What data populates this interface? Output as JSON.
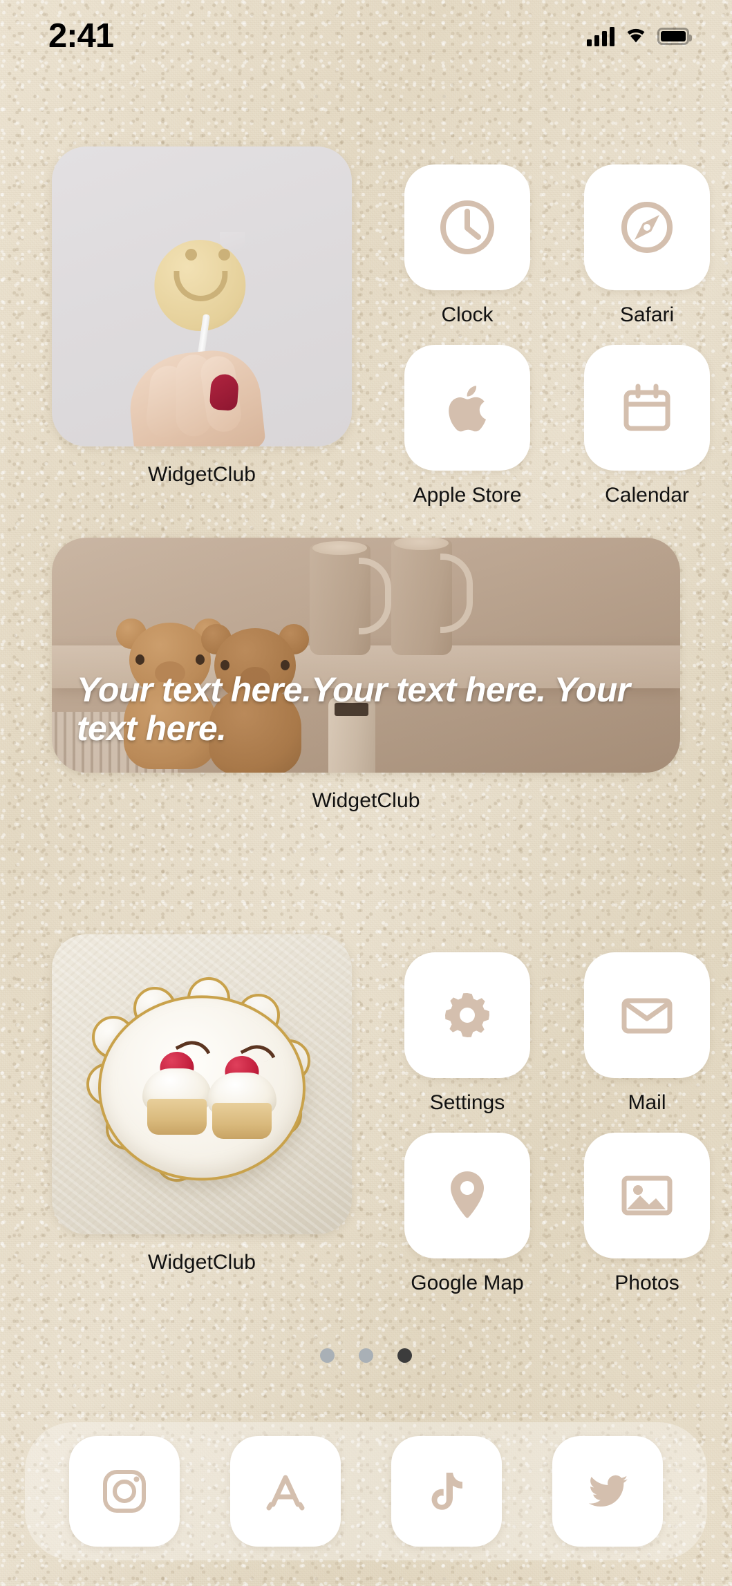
{
  "status_bar": {
    "time": "2:41",
    "signal_icon": "cellular-signal-icon",
    "wifi_icon": "wifi-icon",
    "battery_icon": "battery-icon"
  },
  "theme": {
    "wallpaper_color": "#e7ddc9",
    "icon_tile_color": "#ffffff",
    "icon_glyph_color": "#d4bfae",
    "label_color": "#111111",
    "active_dot_color": "#3c3c3c",
    "inactive_dot_color": "#a9b0b6"
  },
  "home_screen": {
    "widgets": [
      {
        "id": "lollipop",
        "label": "WidgetClub",
        "size": "small",
        "photo": "hand-holding-smiley-lollipop"
      },
      {
        "id": "teddy-bears",
        "label": "WidgetClub",
        "size": "wide",
        "photo": "teddy-bears-with-coffee-mugs",
        "overlay_text": "Your text here.Your text here. Your text here."
      },
      {
        "id": "cupcakes",
        "label": "WidgetClub",
        "size": "small",
        "photo": "cherry-cupcakes-on-gold-rim-plate"
      }
    ],
    "apps": [
      {
        "label": "Clock",
        "icon": "clock-icon"
      },
      {
        "label": "Safari",
        "icon": "compass-icon"
      },
      {
        "label": "Apple Store",
        "icon": "apple-logo-icon"
      },
      {
        "label": "Calendar",
        "icon": "calendar-icon"
      },
      {
        "label": "Settings",
        "icon": "gear-icon"
      },
      {
        "label": "Mail",
        "icon": "envelope-icon"
      },
      {
        "label": "Google Map",
        "icon": "map-pin-icon"
      },
      {
        "label": "Photos",
        "icon": "image-icon"
      }
    ],
    "page_dots": {
      "total": 3,
      "active_index": 2
    }
  },
  "dock": {
    "apps": [
      {
        "name": "Instagram",
        "icon": "instagram-icon"
      },
      {
        "name": "App Store",
        "icon": "app-store-icon"
      },
      {
        "name": "TikTok",
        "icon": "tiktok-icon"
      },
      {
        "name": "Twitter",
        "icon": "twitter-bird-icon"
      }
    ]
  }
}
